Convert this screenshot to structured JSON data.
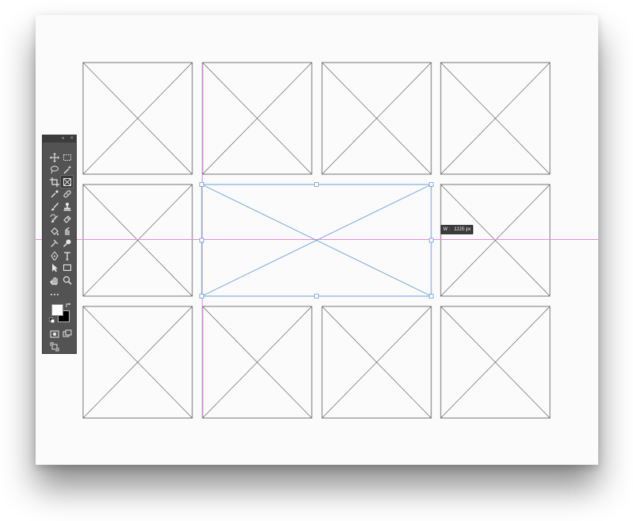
{
  "canvas": {
    "frame_grid": {
      "rows": 3,
      "columns": 4
    },
    "selected_frame": {
      "row": 2,
      "column": 2,
      "column_span": 2
    },
    "guide_color": "#e88ae4",
    "selection_color": "#6a9ee0",
    "frame_stroke_color": "#555555"
  },
  "tooltip": {
    "label": "W :",
    "value": "1225 px"
  },
  "toolbar": {
    "collapse_glyph": "«",
    "close_glyph": "×",
    "tools": [
      "move-tool-icon",
      "marquee-tool-icon",
      "lasso-tool-icon",
      "magic-wand-tool-icon",
      "crop-tool-icon",
      "frame-tool-icon",
      "eyedropper-tool-icon",
      "healing-brush-tool-icon",
      "brush-tool-icon",
      "clone-stamp-tool-icon",
      "history-brush-tool-icon",
      "eraser-tool-icon",
      "paint-bucket-tool-icon",
      "smudge-tool-icon",
      "burn-tool-icon",
      "dodge-tool-icon",
      "pen-tool-icon",
      "type-tool-icon",
      "path-selection-tool-icon",
      "rectangle-tool-icon",
      "hand-tool-icon",
      "zoom-tool-icon",
      "more-tools-icon"
    ],
    "active_tool": "frame-tool-icon",
    "foreground_color": "#ffffff",
    "background_color": "#000000"
  }
}
